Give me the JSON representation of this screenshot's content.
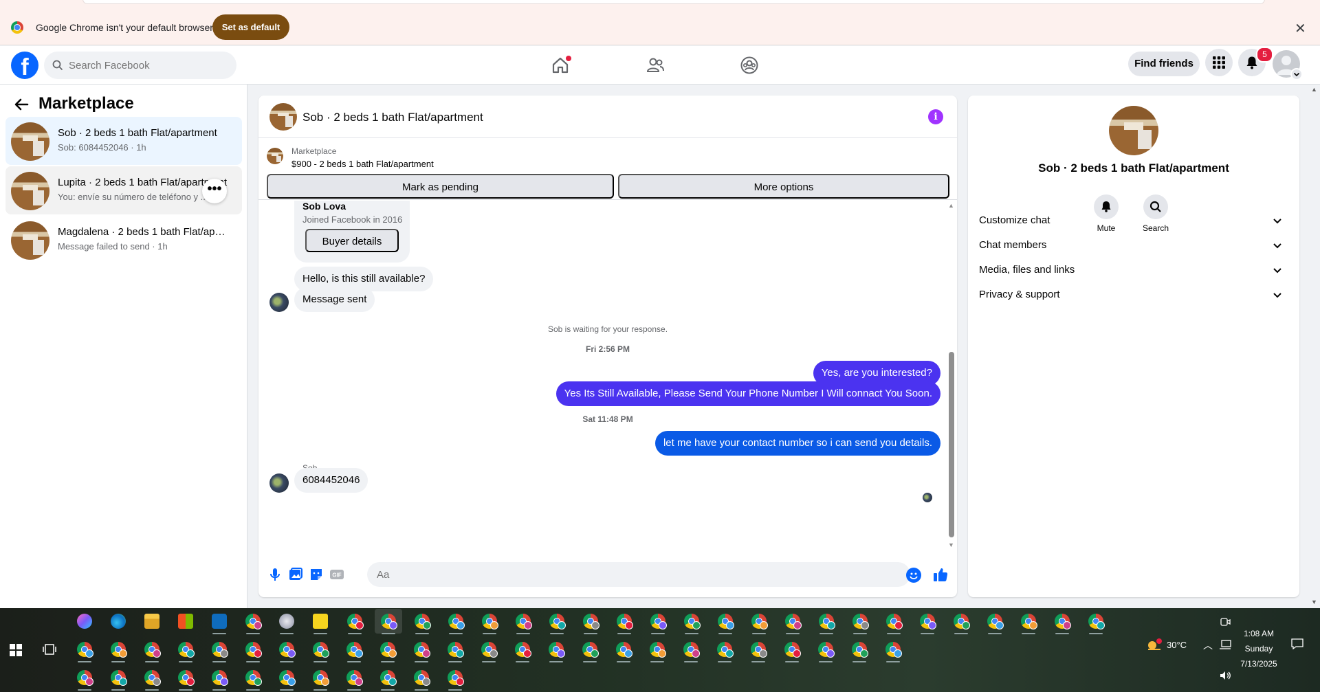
{
  "browser": {
    "infobar_message": "Google Chrome isn't your default browser",
    "set_default_label": "Set as default",
    "close_glyph": "✕"
  },
  "fb": {
    "logo_letter": "f",
    "search_placeholder": "Search Facebook",
    "find_friends_label": "Find friends",
    "notifications_count": "5",
    "brand_color": "#0866ff"
  },
  "sidebar": {
    "title": "Marketplace",
    "conversations": [
      {
        "name": "Sob · 2 beds 1 bath Flat/apartment",
        "preview": "Sob: 6084452046 · 1h"
      },
      {
        "name": "Lupita · 2 beds 1 bath Flat/apartment",
        "preview": "You: envíe su número de teléfono y ... 1h",
        "more_glyph": "•••"
      },
      {
        "name": "Magdalena · 2 beds 1 bath Flat/apartment",
        "preview": "Message failed to send · 1h"
      }
    ]
  },
  "chat": {
    "title": "Sob · 2 beds 1 bath Flat/apartment",
    "info_glyph": "i",
    "listing_source": "Marketplace",
    "listing_price_title": "$900 - 2 beds 1 bath Flat/apartment",
    "mark_pending_label": "Mark as pending",
    "more_options_label": "More options",
    "buyer_name": "Sob Lova",
    "buyer_joined": "Joined Facebook in 2016",
    "buyer_details_label": "Buyer details",
    "messages": [
      {
        "text": "Hello, is this still available?"
      },
      {
        "text": "Message sent"
      },
      {
        "text": "Yes, are you interested?"
      },
      {
        "text": "Yes Its Still Available, Please Send Your Phone Number I Will connact You Soon."
      },
      {
        "text": "let me have your contact number so i can send you details."
      },
      {
        "text": "6084452046"
      }
    ],
    "waiting_notice": "Sob is waiting for your response.",
    "timestamp_1": "Fri 2:56 PM",
    "timestamp_2": "Sat 11:48 PM",
    "sender_label": "Sob",
    "composer_placeholder": "Aa"
  },
  "info_panel": {
    "title": "Sob · 2 beds 1 bath Flat/apartment",
    "mute_label": "Mute",
    "search_label": "Search",
    "sections": [
      {
        "label": "Customize chat"
      },
      {
        "label": "Chat members"
      },
      {
        "label": "Media, files and links"
      },
      {
        "label": "Privacy & support"
      }
    ]
  },
  "taskbar": {
    "temperature": "30°C",
    "time": "1:08 AM",
    "day": "Sunday",
    "date": "7/13/2025"
  }
}
